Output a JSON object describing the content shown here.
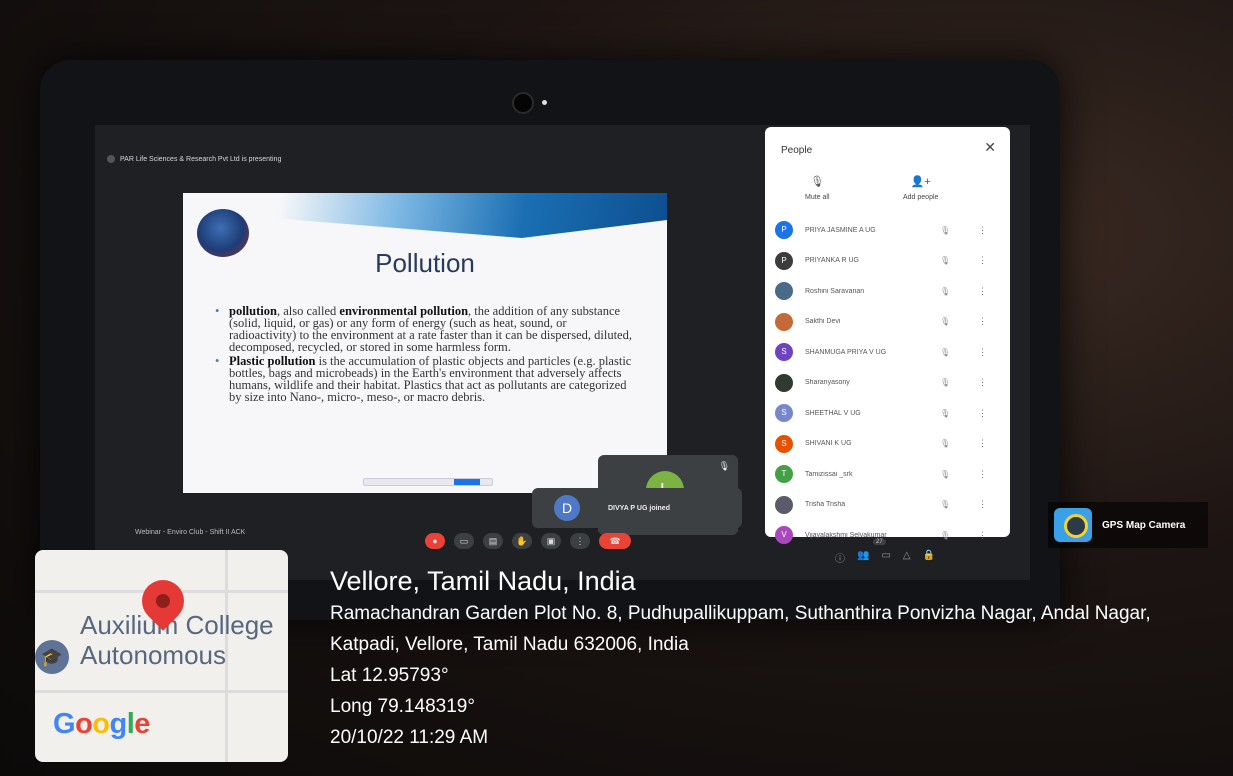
{
  "screen": {
    "presenting_text": "PAR Life Sciences & Research Pvt Ltd is presenting",
    "meeting_name": "Webinar - Enviro Club - Shift II ACK",
    "participant_count": "27"
  },
  "slide": {
    "title": "Pollution",
    "bullet1_term": "pollution",
    "bullet1_mid": ", also called ",
    "bullet1_term2": "environmental pollution",
    "bullet1_rest": ", the addition of any substance (solid, liquid, or gas) or any form of energy (such as heat, sound, or radioactivity) to the environment at a rate faster than it can be dispersed, diluted, decomposed, recycled, or stored in some harmless form.",
    "bullet2_term": "Plastic pollution",
    "bullet2_rest": " is the accumulation of plastic objects and particles (e.g. plastic bottles, bags and microbeads) in the Earth's environment that adversely affects humans, wildlife and their habitat. Plastics that act as pollutants are categorized by size into Nano-, micro-, meso-, or macro debris."
  },
  "tiles": {
    "main_avatar": "L",
    "toast_avatar": "D",
    "toast_message": "DIVYA P UG joined"
  },
  "people_panel": {
    "title": "People",
    "mute_all": "Mute all",
    "add_people": "Add people",
    "participants": [
      {
        "initial": "P",
        "name": "PRIYA JASMINE A UG",
        "color": "#1a73e8"
      },
      {
        "initial": "P",
        "name": "PRIYANKA R UG",
        "color": "#3c3c3c"
      },
      {
        "initial": "",
        "name": "Roshini Saravanan",
        "color": "#4a6a8a"
      },
      {
        "initial": "",
        "name": "Sakthi Devi",
        "color": "#c46a3a"
      },
      {
        "initial": "S",
        "name": "SHANMUGA PRIYA V UG",
        "color": "#6f42c1"
      },
      {
        "initial": "",
        "name": "Sharanyasony",
        "color": "#2f3a30"
      },
      {
        "initial": "S",
        "name": "SHEETHAL V UG",
        "color": "#7986cb"
      },
      {
        "initial": "S",
        "name": "SHIVANI K UG",
        "color": "#e65100"
      },
      {
        "initial": "T",
        "name": "Tamizissai _srk",
        "color": "#43a047"
      },
      {
        "initial": "",
        "name": "Trisha Trisha",
        "color": "#5a5a6a"
      },
      {
        "initial": "V",
        "name": "Vijayalakshmi Selvakumar",
        "color": "#ab47bc"
      }
    ]
  },
  "gps": {
    "map_label_line1": "Auxilium College",
    "map_label_line2": "Autonomous",
    "google": "Google",
    "city": "Vellore, Tamil Nadu, India",
    "address": "Ramachandran Garden Plot No. 8, Pudhupallikuppam, Suthanthira Ponvizha Nagar, Andal Nagar, Katpadi, Vellore, Tamil Nadu 632006, India",
    "lat": "Lat 12.95793°",
    "long": "Long 79.148319°",
    "datetime": "20/10/22 11:29 AM",
    "brand": "GPS Map Camera"
  }
}
